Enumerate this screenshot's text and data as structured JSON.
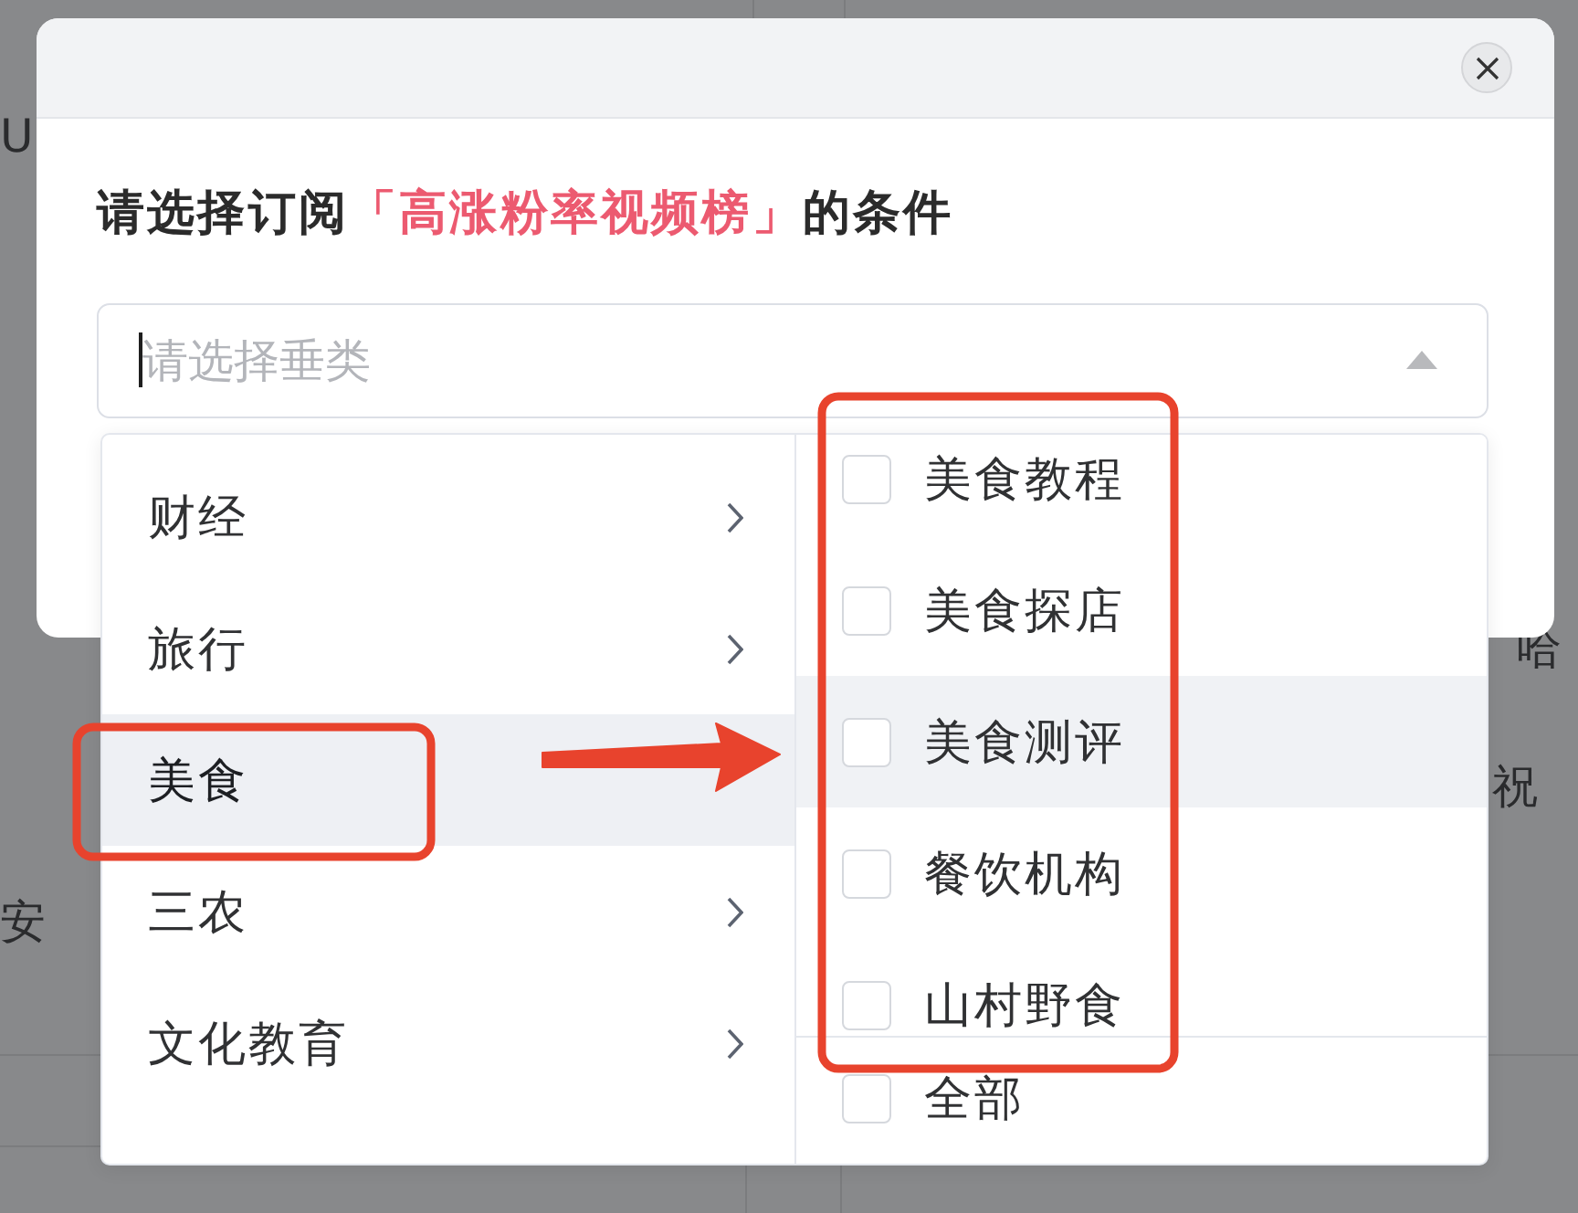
{
  "page_behind": {
    "left_texts": [
      "U",
      "安"
    ],
    "right_texts": [
      "哈",
      "祝"
    ]
  },
  "dialog": {
    "title": [
      {
        "text": "请选择订阅",
        "kind": "plain"
      },
      {
        "text": "「高涨粉率视频榜」",
        "kind": "highlight"
      },
      {
        "text": "的条件",
        "kind": "plain"
      }
    ],
    "select": {
      "placeholder": "请选择垂类",
      "expanded": true,
      "focused": true
    }
  },
  "dropdown": {
    "categories": [
      {
        "label": "财经",
        "selected": false
      },
      {
        "label": "旅行",
        "selected": false
      },
      {
        "label": "美食",
        "selected": true
      },
      {
        "label": "三农",
        "selected": false
      },
      {
        "label": "文化教育",
        "selected": false
      }
    ],
    "options": [
      {
        "label": "美食教程",
        "checked": false,
        "hovered": false
      },
      {
        "label": "美食探店",
        "checked": false,
        "hovered": false
      },
      {
        "label": "美食测评",
        "checked": false,
        "hovered": true
      },
      {
        "label": "餐饮机构",
        "checked": false,
        "hovered": false
      },
      {
        "label": "山村野食",
        "checked": false,
        "hovered": false
      }
    ],
    "select_all": {
      "label": "全部",
      "checked": false
    }
  }
}
